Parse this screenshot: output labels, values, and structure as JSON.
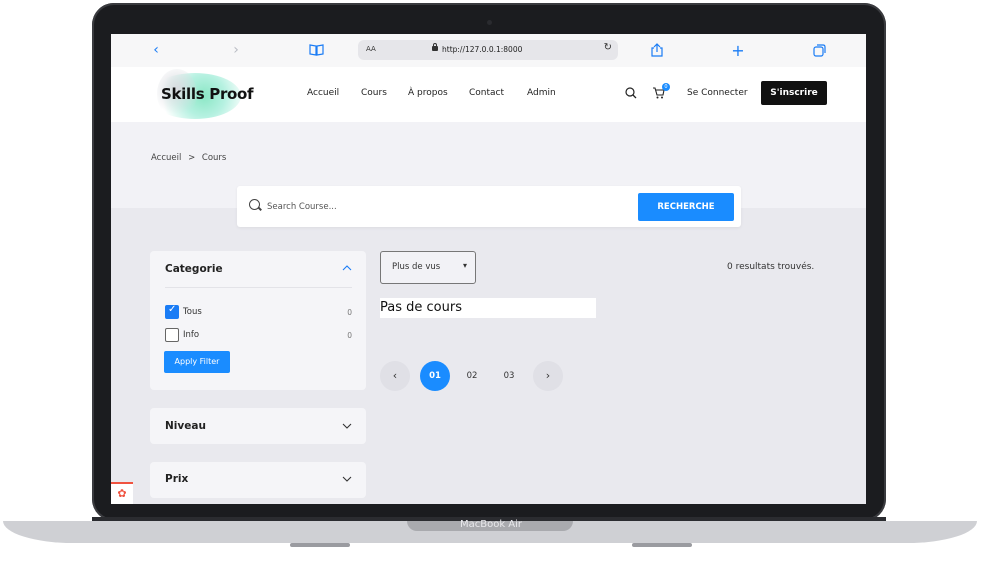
{
  "device": {
    "label": "MacBook Air"
  },
  "browser": {
    "url": "http://127.0.0.1:8000",
    "aa_label": "AA",
    "back_icon": "chevron-left-icon",
    "forward_icon": "chevron-right-icon"
  },
  "header": {
    "logo": "Skills Proof",
    "nav": [
      "Accueil",
      "Cours",
      "À propos",
      "Contact",
      "Admin"
    ],
    "cart_count": "0",
    "login": "Se Connecter",
    "signup": "S'inscrire"
  },
  "breadcrumb": {
    "home": "Accueil",
    "separator": ">",
    "current": "Cours"
  },
  "search": {
    "placeholder": "Search Course...",
    "button": "RECHERCHE"
  },
  "filters": {
    "category": {
      "title": "Categorie",
      "options": [
        {
          "label": "Tous",
          "count": "0",
          "checked": true
        },
        {
          "label": "Info",
          "count": "0",
          "checked": false
        }
      ],
      "apply": "Apply Filter"
    },
    "level": {
      "title": "Niveau"
    },
    "price": {
      "title": "Prix"
    }
  },
  "results": {
    "sort_selected": "Plus de vus",
    "count_text": "0 resultats trouvés.",
    "empty": "Pas de cours"
  },
  "pagination": {
    "pages": [
      "01",
      "02",
      "03"
    ],
    "active": "01"
  },
  "colors": {
    "accent": "#1a8cff",
    "dark": "#111111",
    "page_bg": "#f2f2f6"
  }
}
